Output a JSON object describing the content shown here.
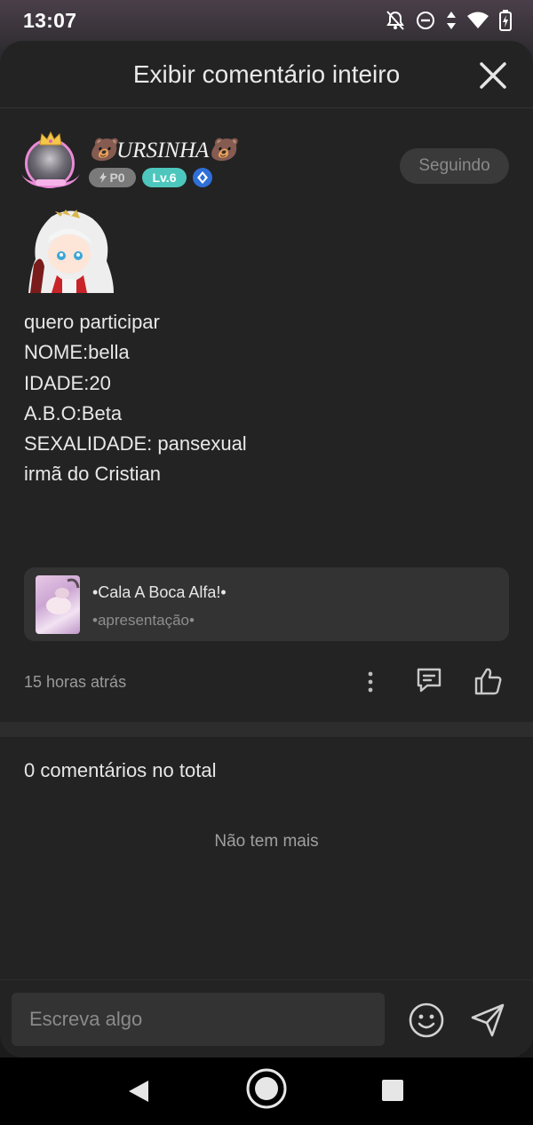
{
  "status_bar": {
    "time": "13:07",
    "icons": [
      "notifications-off-icon",
      "do-not-disturb-icon",
      "data-arrows-icon",
      "wifi-icon",
      "battery-charging-icon"
    ]
  },
  "header": {
    "title": "Exibir comentário inteiro",
    "close_icon": "close-icon"
  },
  "comment": {
    "author": {
      "name": "🐻URSINHA🐻",
      "badge_points": "P0",
      "badge_level": "Lv.6"
    },
    "follow_label": "Seguindo",
    "lines": [
      "quero participar",
      "NOME:bella",
      "IDADE:20",
      "A.B.O:Beta",
      "SEXALIDADE: pansexual",
      "irmã do Cristian"
    ],
    "reference": {
      "title": "•Cala A Boca Alfa!•",
      "subtitle": "•apresentação•"
    },
    "time_ago": "15 horas atrás"
  },
  "comments_section": {
    "total_label": "0 comentários no total",
    "empty_label": "Não tem mais"
  },
  "composer": {
    "placeholder": "Escreva algo",
    "emoji_icon": "emoji-icon",
    "send_icon": "send-icon"
  },
  "colors": {
    "background": "#232323",
    "level_badge": "#4dc7bd",
    "points_badge": "#7a7a7a",
    "card": "#333333"
  }
}
